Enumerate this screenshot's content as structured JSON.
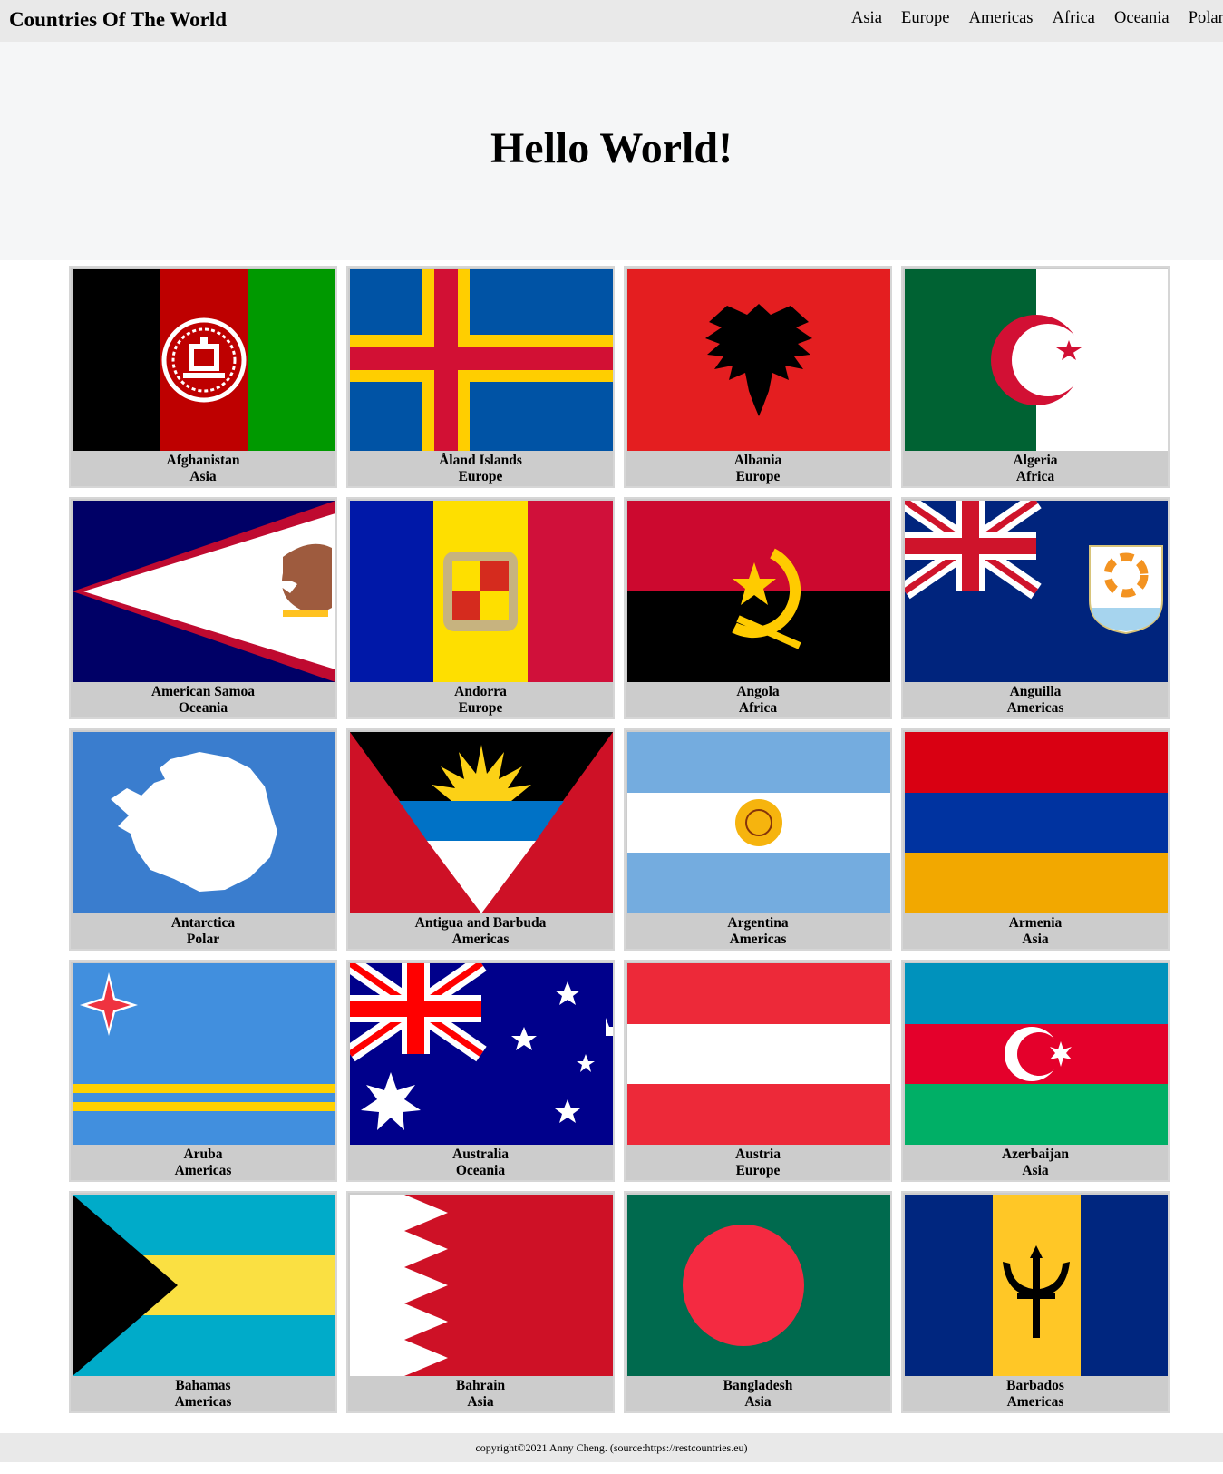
{
  "site": {
    "title": "Countries Of The World"
  },
  "nav": [
    "Asia",
    "Europe",
    "Americas",
    "Africa",
    "Oceania",
    "Polar"
  ],
  "hero": {
    "heading": "Hello World!"
  },
  "countries": [
    {
      "name": "Afghanistan",
      "region": "Asia"
    },
    {
      "name": "Åland Islands",
      "region": "Europe"
    },
    {
      "name": "Albania",
      "region": "Europe"
    },
    {
      "name": "Algeria",
      "region": "Africa"
    },
    {
      "name": "American Samoa",
      "region": "Oceania"
    },
    {
      "name": "Andorra",
      "region": "Europe"
    },
    {
      "name": "Angola",
      "region": "Africa"
    },
    {
      "name": "Anguilla",
      "region": "Americas"
    },
    {
      "name": "Antarctica",
      "region": "Polar"
    },
    {
      "name": "Antigua and Barbuda",
      "region": "Americas"
    },
    {
      "name": "Argentina",
      "region": "Americas"
    },
    {
      "name": "Armenia",
      "region": "Asia"
    },
    {
      "name": "Aruba",
      "region": "Americas"
    },
    {
      "name": "Australia",
      "region": "Oceania"
    },
    {
      "name": "Austria",
      "region": "Europe"
    },
    {
      "name": "Azerbaijan",
      "region": "Asia"
    },
    {
      "name": "Bahamas",
      "region": "Americas"
    },
    {
      "name": "Bahrain",
      "region": "Asia"
    },
    {
      "name": "Bangladesh",
      "region": "Asia"
    },
    {
      "name": "Barbados",
      "region": "Americas"
    }
  ],
  "footer": {
    "text": "copyright©2021 Anny Cheng. (source:https://restcountries.eu)"
  }
}
